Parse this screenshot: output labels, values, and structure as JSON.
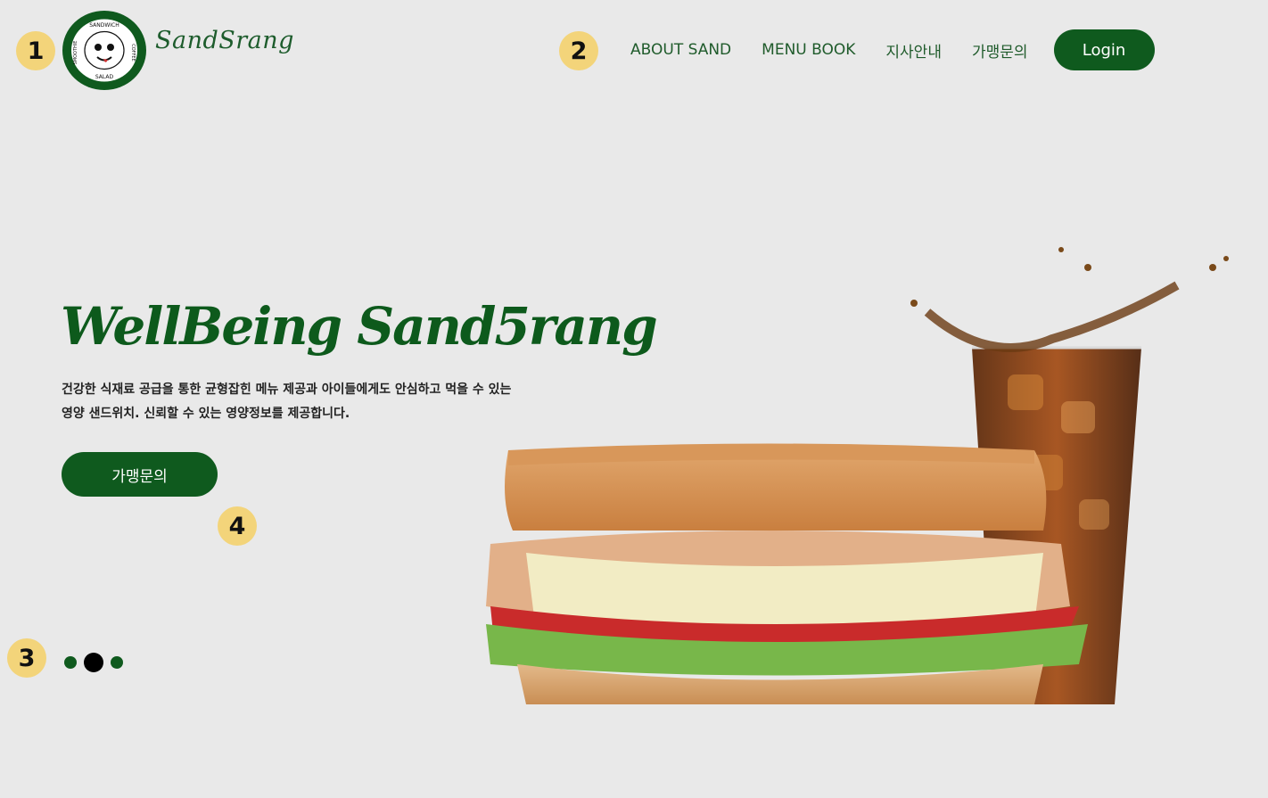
{
  "markers": [
    "1",
    "2",
    "3",
    "4"
  ],
  "brand": {
    "name": "SandSrang",
    "badge_text_top": "SANDWICH",
    "badge_text_right": "COFFEE",
    "badge_text_bottom": "SALAD",
    "badge_text_left": "SMOOTHIE"
  },
  "nav": {
    "items": [
      "ABOUT SAND",
      "MENU BOOK",
      "지사안내",
      "가맹문의"
    ],
    "login_label": "Login"
  },
  "hero": {
    "title": "WellBeing Sand5rang",
    "desc_line1": "건강한 식재료 공급을 통한 균형잡힌 메뉴 제공과 아이들에게도 안심하고 먹을 수 있는",
    "desc_line2": "영양 샌드위치. 신뢰할 수 있는 영양정보를 제공합니다.",
    "cta_label": "가맹문의"
  },
  "slider": {
    "count": 3,
    "active_index": 1
  },
  "colors": {
    "brand_green": "#0f5a1e",
    "background": "#e9e9e9",
    "marker_yellow": "#f3d47a"
  }
}
